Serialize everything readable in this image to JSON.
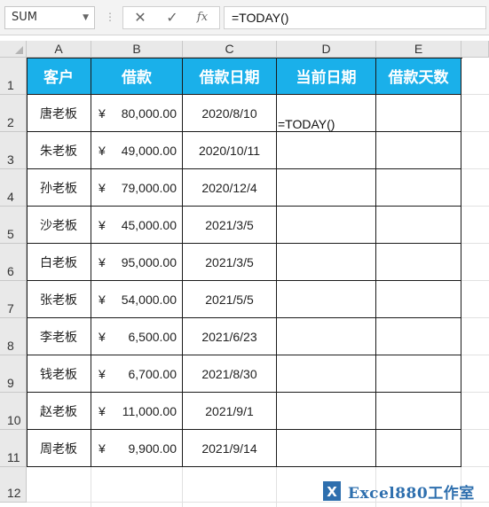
{
  "formula_bar": {
    "name_box": "SUM",
    "cancel_icon": "close-icon",
    "enter_icon": "check-icon",
    "fx_label": "fx",
    "formula": "=TODAY()"
  },
  "columns": [
    "A",
    "B",
    "C",
    "D",
    "E"
  ],
  "rows": [
    "1",
    "2",
    "3",
    "4",
    "5",
    "6",
    "7",
    "8",
    "9",
    "10",
    "11",
    "12"
  ],
  "table": {
    "headers": [
      "客户",
      "借款",
      "借款日期",
      "当前日期",
      "借款天数"
    ],
    "currency_symbol": "¥",
    "records": [
      {
        "customer": "唐老板",
        "amount": "80,000.00",
        "date": "2020/8/10"
      },
      {
        "customer": "朱老板",
        "amount": "49,000.00",
        "date": "2020/10/11"
      },
      {
        "customer": "孙老板",
        "amount": "79,000.00",
        "date": "2020/12/4"
      },
      {
        "customer": "沙老板",
        "amount": "45,000.00",
        "date": "2021/3/5"
      },
      {
        "customer": "白老板",
        "amount": "95,000.00",
        "date": "2021/3/5"
      },
      {
        "customer": "张老板",
        "amount": "54,000.00",
        "date": "2021/5/5"
      },
      {
        "customer": "李老板",
        "amount": "6,500.00",
        "date": "2021/6/23"
      },
      {
        "customer": "钱老板",
        "amount": "6,700.00",
        "date": "2021/8/30"
      },
      {
        "customer": "赵老板",
        "amount": "11,000.00",
        "date": "2021/9/1"
      },
      {
        "customer": "周老板",
        "amount": "9,900.00",
        "date": "2021/9/14"
      }
    ]
  },
  "editing_cell_text": "=TODAY()",
  "watermark": "Excel880工作室",
  "colors": {
    "header_fill": "#1ab0ea",
    "header_text": "#ffffff"
  }
}
